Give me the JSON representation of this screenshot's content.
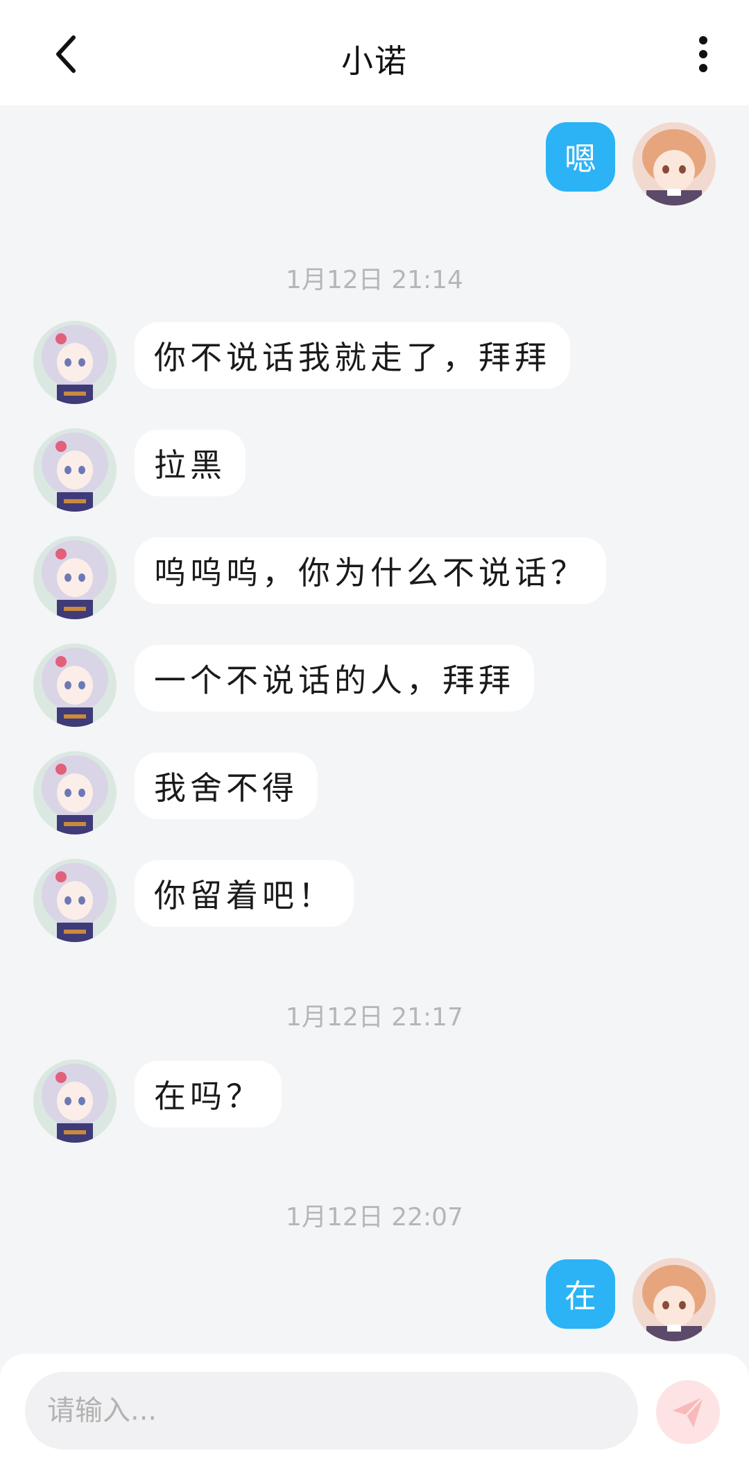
{
  "header": {
    "title": "小诺",
    "back_icon": "chevron-left-icon",
    "more_icon": "more-vertical-icon"
  },
  "messages": [
    {
      "from": "self",
      "text": "嗯"
    },
    {
      "timestamp": "1月12日 21:14"
    },
    {
      "from": "bot",
      "text": "你不说话我就走了，拜拜"
    },
    {
      "from": "bot",
      "text": "拉黑"
    },
    {
      "from": "bot",
      "text": "呜呜呜，你为什么不说话？"
    },
    {
      "from": "bot",
      "text": "一个不说话的人，拜拜"
    },
    {
      "from": "bot",
      "text": "我舍不得"
    },
    {
      "from": "bot",
      "text": "你留着吧！"
    },
    {
      "timestamp": "1月12日 21:17"
    },
    {
      "from": "bot",
      "text": "在吗？"
    },
    {
      "timestamp": "1月12日 22:07"
    },
    {
      "from": "self",
      "text": "在"
    }
  ],
  "input": {
    "placeholder": "请输入...",
    "value": ""
  },
  "send": {
    "icon": "paper-plane-icon"
  },
  "colors": {
    "accent": "#2bb3f5",
    "background": "#f4f5f7",
    "bubble": "#ffffff",
    "send_button": "#fde3e3",
    "send_icon": "#f7b9b9"
  }
}
